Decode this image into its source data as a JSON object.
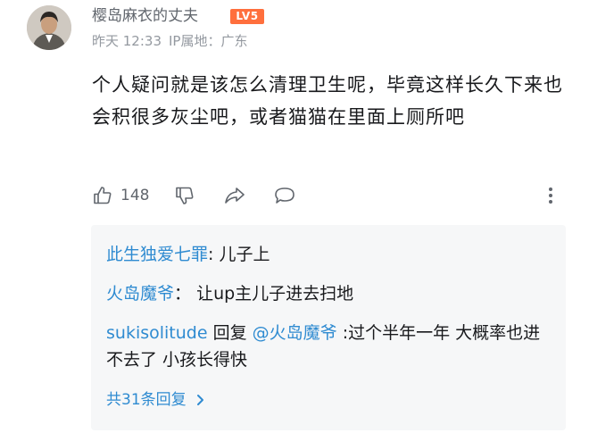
{
  "comment": {
    "username": "樱岛麻衣的丈夫",
    "level_badge": "LV5",
    "time": "昨天 12:33",
    "ip": "IP属地：广东",
    "text": "个人疑问就是该怎么清理卫生呢，毕竟这样长久下来也会积很多灰尘吧，或者猫猫在里面上厕所吧",
    "like_count": "148"
  },
  "replies": [
    {
      "user": "此生独爱七罪",
      "sep": ": ",
      "text": "儿子上"
    },
    {
      "user": "火岛魔爷",
      "sep": "： ",
      "text": "让up主儿子进去扫地"
    },
    {
      "user": "sukisolitude",
      "reply_word": " 回复 ",
      "reply_to": "@火岛魔爷",
      "text": " :过个半年一年 大概率也进不去了 小孩长得快"
    }
  ],
  "more_replies": "共31条回复",
  "colors": {
    "link": "#2f8bd1",
    "level_badge": "#ff6f3d",
    "meta": "#9499a0",
    "reply_panel": "#f6f7f8"
  },
  "icons": [
    "thumb-up-icon",
    "thumb-down-icon",
    "share-icon",
    "chat-bubble-icon",
    "more-vertical-icon",
    "chevron-right-icon"
  ]
}
